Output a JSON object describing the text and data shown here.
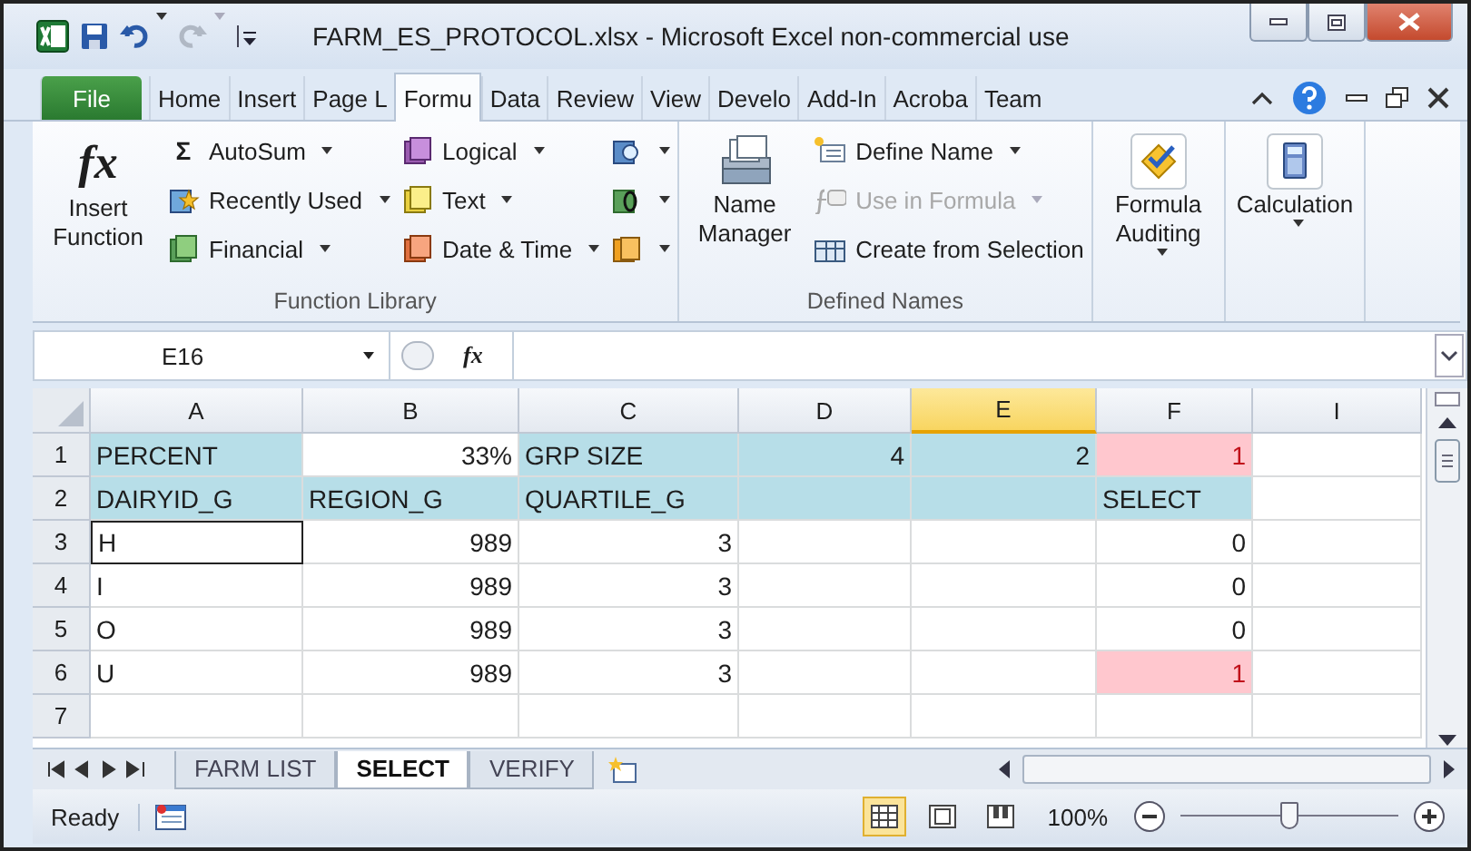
{
  "window": {
    "title": "FARM_ES_PROTOCOL.xlsx  -  Microsoft Excel non-commercial use"
  },
  "quick_access": [
    {
      "kind": "save",
      "disabled": false
    },
    {
      "kind": "undo",
      "disabled": false
    },
    {
      "kind": "redo",
      "disabled": true
    }
  ],
  "tabs": [
    {
      "label": "File",
      "kind": "file",
      "selected": false
    },
    {
      "label": "Home",
      "kind": "tab",
      "selected": false
    },
    {
      "label": "Insert",
      "kind": "tab",
      "selected": false
    },
    {
      "label": "Page L",
      "kind": "tab",
      "selected": false
    },
    {
      "label": "Formu",
      "kind": "tab",
      "selected": true
    },
    {
      "label": "Data",
      "kind": "tab",
      "selected": false
    },
    {
      "label": "Review",
      "kind": "tab",
      "selected": false
    },
    {
      "label": "View",
      "kind": "tab",
      "selected": false
    },
    {
      "label": "Develo",
      "kind": "tab",
      "selected": false
    },
    {
      "label": "Add-In",
      "kind": "tab",
      "selected": false
    },
    {
      "label": "Acroba",
      "kind": "tab",
      "selected": false
    },
    {
      "label": "Team",
      "kind": "tab",
      "selected": false
    }
  ],
  "ribbon": {
    "groups": [
      {
        "label": "Function Library",
        "large": [
          {
            "label": "Insert Function",
            "icon_text": "fx",
            "dropdown": false
          }
        ],
        "columns": [
          [
            {
              "label": "AutoSum",
              "icon_text": "Σ",
              "dropdown": true,
              "disabled": false
            },
            {
              "label": "Recently Used",
              "dropdown": true,
              "disabled": false
            },
            {
              "label": "Financial",
              "dropdown": true,
              "disabled": false
            }
          ],
          [
            {
              "label": "Logical",
              "dropdown": true,
              "disabled": false
            },
            {
              "label": "Text",
              "dropdown": true,
              "disabled": false
            },
            {
              "label": "Date & Time",
              "dropdown": true,
              "disabled": false
            }
          ],
          [
            {
              "dropdown": true,
              "disabled": false
            },
            {
              "dropdown": true,
              "disabled": false
            },
            {
              "dropdown": true,
              "disabled": false
            }
          ]
        ]
      },
      {
        "label": "Defined Names",
        "large": [
          {
            "label": "Name Manager",
            "dropdown": false
          }
        ],
        "columns": [
          [
            {
              "label": "Define Name",
              "dropdown": true,
              "disabled": false
            },
            {
              "label": "Use in Formula",
              "dropdown": true,
              "disabled": true
            },
            {
              "label": "Create from Selection",
              "dropdown": false,
              "disabled": false
            }
          ]
        ]
      },
      {
        "large": [
          {
            "label": "Formula Auditing",
            "dropdown": true
          }
        ]
      },
      {
        "large": [
          {
            "label": "Calculation",
            "dropdown": true
          }
        ]
      }
    ]
  },
  "formula_bar": {
    "name_box": "E16",
    "function_label": "fx"
  },
  "columns": [
    {
      "label": "A",
      "selected": false
    },
    {
      "label": "B",
      "selected": false
    },
    {
      "label": "C",
      "selected": false
    },
    {
      "label": "D",
      "selected": false
    },
    {
      "label": "E",
      "selected": true
    },
    {
      "label": "F",
      "selected": false
    },
    {
      "label": "I",
      "selected": false
    }
  ],
  "rows": [
    {
      "header": "1",
      "cells": [
        {
          "text": "PERCENT",
          "kind": "text",
          "color": "#b7dee8"
        },
        {
          "text": "33%",
          "kind": "number"
        },
        {
          "text": "GRP SIZE",
          "kind": "text",
          "color": "#b7dee8"
        },
        {
          "text": "4",
          "kind": "number",
          "color": "#b7dee8"
        },
        {
          "text": "2",
          "kind": "number",
          "color": "#b7dee8"
        },
        {
          "text": "1",
          "kind": "number",
          "color": "#ffc7ce",
          "alert": true
        },
        {
          "kind": "empty"
        }
      ]
    },
    {
      "header": "2",
      "cells": [
        {
          "text": "DAIRYID_G",
          "kind": "text",
          "color": "#b7dee8"
        },
        {
          "text": "REGION_G",
          "kind": "text",
          "color": "#b7dee8"
        },
        {
          "text": "QUARTILE_G",
          "kind": "text",
          "color": "#b7dee8"
        },
        {
          "kind": "empty",
          "color": "#b7dee8"
        },
        {
          "kind": "empty",
          "color": "#b7dee8"
        },
        {
          "text": "SELECT",
          "kind": "text",
          "color": "#b7dee8"
        },
        {
          "kind": "empty"
        }
      ]
    },
    {
      "header": "3",
      "cells": [
        {
          "text": "H",
          "kind": "boxed"
        },
        {
          "text": "989",
          "kind": "number"
        },
        {
          "text": "3",
          "kind": "number"
        },
        {
          "kind": "empty"
        },
        {
          "kind": "empty"
        },
        {
          "text": "0",
          "kind": "number"
        },
        {
          "kind": "empty"
        }
      ]
    },
    {
      "header": "4",
      "cells": [
        {
          "text": "I",
          "kind": "text"
        },
        {
          "text": "989",
          "kind": "number"
        },
        {
          "text": "3",
          "kind": "number"
        },
        {
          "kind": "empty"
        },
        {
          "kind": "empty"
        },
        {
          "text": "0",
          "kind": "number"
        },
        {
          "kind": "empty"
        }
      ]
    },
    {
      "header": "5",
      "cells": [
        {
          "text": "O",
          "kind": "text"
        },
        {
          "text": "989",
          "kind": "number"
        },
        {
          "text": "3",
          "kind": "number"
        },
        {
          "kind": "empty"
        },
        {
          "kind": "empty"
        },
        {
          "text": "0",
          "kind": "number"
        },
        {
          "kind": "empty"
        }
      ]
    },
    {
      "header": "6",
      "cells": [
        {
          "text": "U",
          "kind": "text"
        },
        {
          "text": "989",
          "kind": "number"
        },
        {
          "text": "3",
          "kind": "number"
        },
        {
          "kind": "empty"
        },
        {
          "kind": "empty"
        },
        {
          "text": "1",
          "kind": "number",
          "color": "#ffc7ce",
          "alert": true
        },
        {
          "kind": "empty"
        }
      ]
    },
    {
      "header": "7",
      "cells": [
        {
          "kind": "empty"
        },
        {
          "kind": "empty"
        },
        {
          "kind": "empty"
        },
        {
          "kind": "empty"
        },
        {
          "kind": "empty"
        },
        {
          "kind": "empty"
        },
        {
          "kind": "empty"
        }
      ]
    }
  ],
  "sheet_tabs": [
    {
      "label": "FARM LIST",
      "selected": false
    },
    {
      "label": "SELECT",
      "selected": true
    },
    {
      "label": "VERIFY",
      "selected": false
    }
  ],
  "status_bar": {
    "status": "Ready",
    "views": [
      {
        "kind": "normal",
        "selected": true
      },
      {
        "kind": "layout",
        "selected": false
      },
      {
        "kind": "break",
        "selected": false
      }
    ],
    "zoom": "100%",
    "zoom_slider": {
      "level": 0.5
    }
  }
}
